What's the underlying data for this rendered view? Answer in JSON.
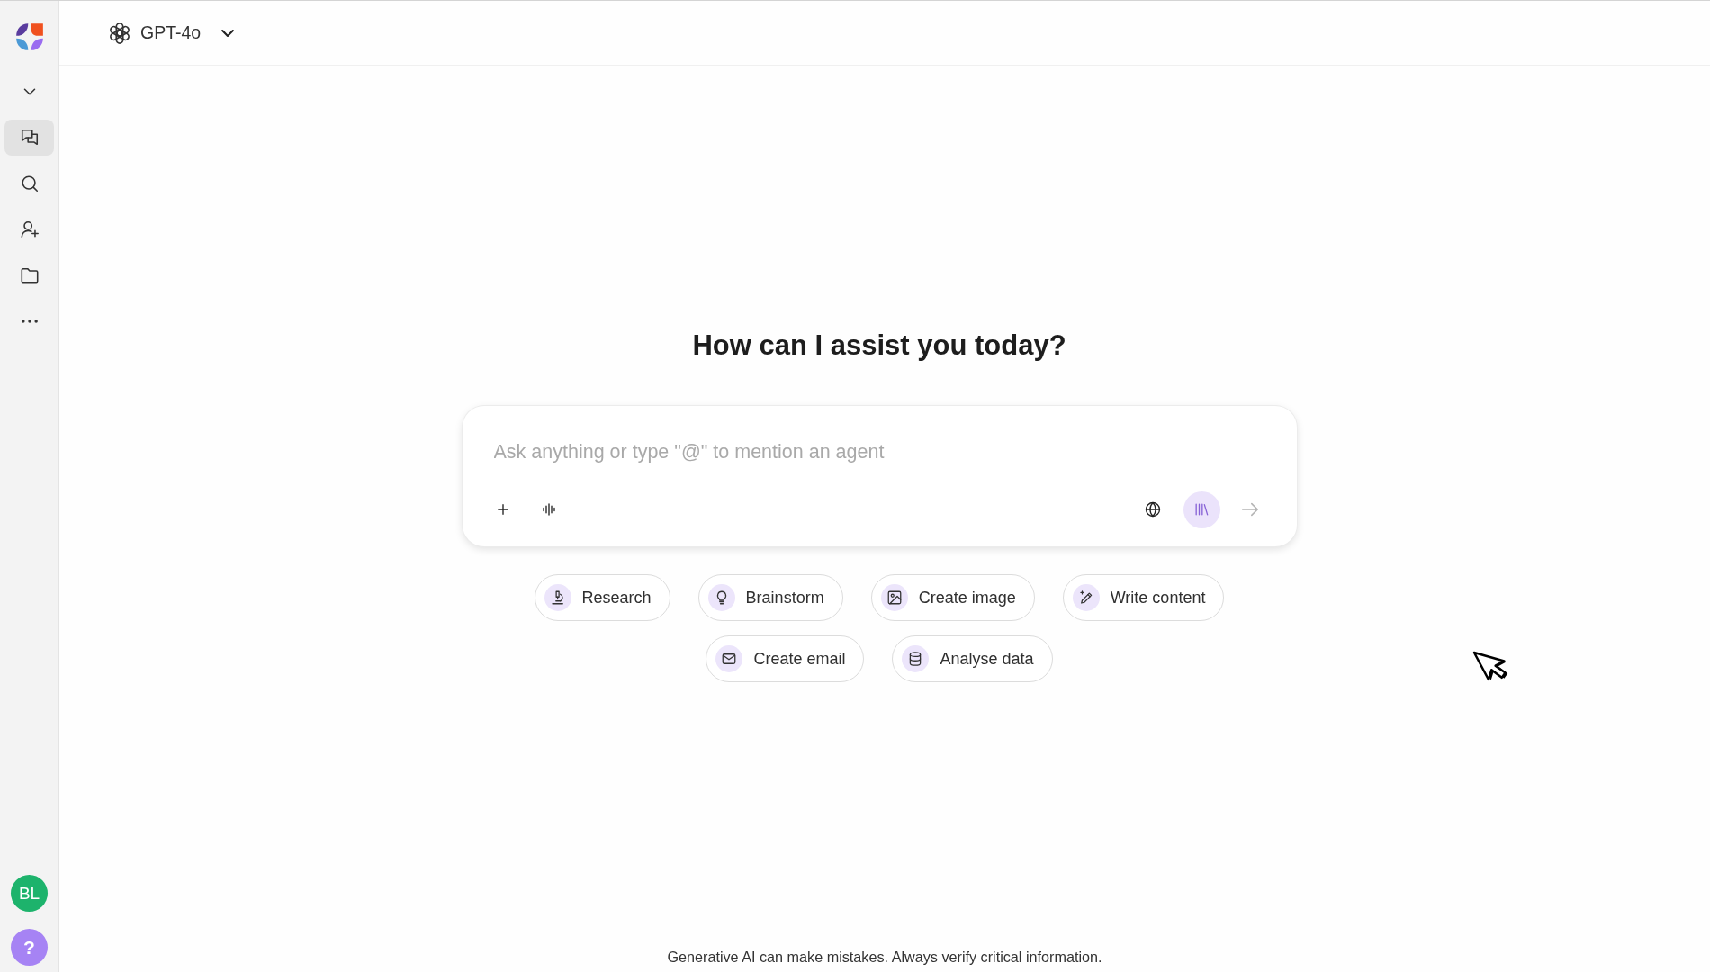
{
  "sidebar": {
    "items": [
      {
        "kind": "collapse",
        "selected": false
      },
      {
        "kind": "chats",
        "selected": true
      },
      {
        "kind": "search",
        "selected": false
      },
      {
        "kind": "agents",
        "selected": false
      },
      {
        "kind": "folders",
        "selected": false
      },
      {
        "kind": "more",
        "selected": false
      }
    ],
    "avatar": {
      "initials": "BL"
    },
    "help": {
      "label": "?"
    }
  },
  "header": {
    "model": "GPT-4o"
  },
  "heading": "How can I assist you today?",
  "composer": {
    "placeholder": "Ask anything or type \"@\" to mention an agent",
    "left_tools": [
      {
        "kind": "attach"
      },
      {
        "kind": "voice"
      }
    ],
    "right_tools": [
      {
        "kind": "web",
        "on": false
      },
      {
        "kind": "library",
        "on": true
      }
    ],
    "send": {
      "disabled": true
    }
  },
  "suggestions": [
    {
      "kind": "research",
      "label": "Research"
    },
    {
      "kind": "brainstorm",
      "label": "Brainstorm"
    },
    {
      "kind": "image",
      "label": "Create image"
    },
    {
      "kind": "write",
      "label": "Write content"
    },
    {
      "kind": "email",
      "label": "Create email"
    },
    {
      "kind": "data",
      "label": "Analyse data"
    }
  ],
  "disclaimer": "Generative AI can make mistakes. Always verify critical information."
}
